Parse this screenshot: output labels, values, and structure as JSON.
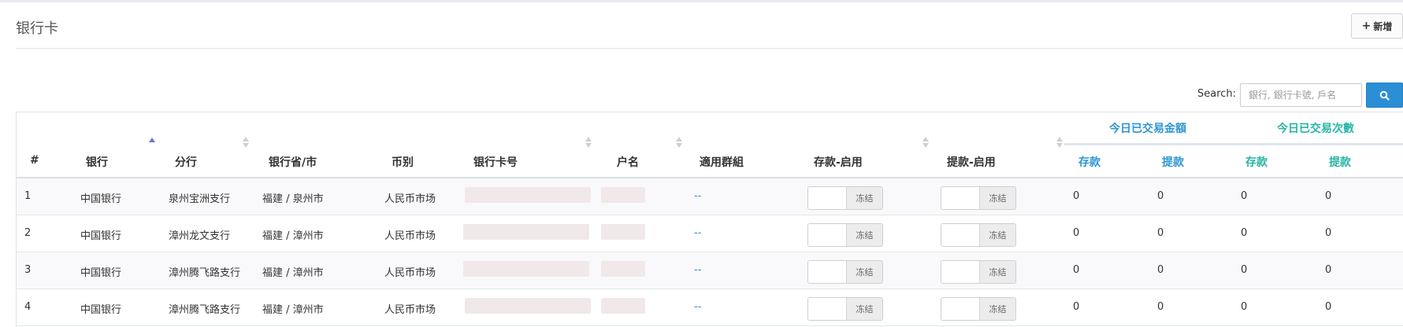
{
  "page": {
    "title": "银行卡"
  },
  "toolbar": {
    "add_plus": "+",
    "add_label": "新增"
  },
  "search": {
    "label": "Search:",
    "placeholder": "銀行, 銀行卡號, 戶名"
  },
  "table": {
    "columns": {
      "index": "#",
      "bank": "银行",
      "branch": "分行",
      "province_city": "银行省/市",
      "currency": "币别",
      "card_no": "银行卡号",
      "account_name": "户名",
      "applicable_group": "適用群組",
      "deposit_enabled": "存款-启用",
      "withdraw_enabled": "提款-启用"
    },
    "groups": {
      "amount": "今日已交易金額",
      "count": "今日已交易次數"
    },
    "sub": {
      "deposit": "存款",
      "withdraw": "提款"
    },
    "toggle_off_label": "冻结",
    "rows": [
      {
        "index": "1",
        "bank": "中国银行",
        "branch": "泉州宝洲支行",
        "province_city": "福建 / 泉州市",
        "currency": "人民币市场",
        "group": "--",
        "amt_deposit": "0",
        "amt_withdraw": "0",
        "cnt_deposit": "0",
        "cnt_withdraw": "0"
      },
      {
        "index": "2",
        "bank": "中国银行",
        "branch": "漳州龙文支行",
        "province_city": "福建 / 漳州市",
        "currency": "人民币市场",
        "group": "--",
        "amt_deposit": "0",
        "amt_withdraw": "0",
        "cnt_deposit": "0",
        "cnt_withdraw": "0"
      },
      {
        "index": "3",
        "bank": "中国银行",
        "branch": "漳州腾飞路支行",
        "province_city": "福建 / 漳州市",
        "currency": "人民币市场",
        "group": "--",
        "amt_deposit": "0",
        "amt_withdraw": "0",
        "cnt_deposit": "0",
        "cnt_withdraw": "0"
      },
      {
        "index": "4",
        "bank": "中国银行",
        "branch": "漳州腾飞路支行",
        "province_city": "福建 / 漳州市",
        "currency": "人民币市场",
        "group": "--",
        "amt_deposit": "0",
        "amt_withdraw": "0",
        "cnt_deposit": "0",
        "cnt_withdraw": "0"
      }
    ]
  },
  "colors": {
    "accent_blue": "#2e96d3",
    "accent_teal": "#26b4a6",
    "search_button": "#2b8fd6",
    "redacted_mask": "#f1e8ea"
  },
  "icons": {
    "add": "plus-icon",
    "search": "search-icon",
    "sort": "sort-icon",
    "sort_asc": "sort-asc-icon"
  }
}
